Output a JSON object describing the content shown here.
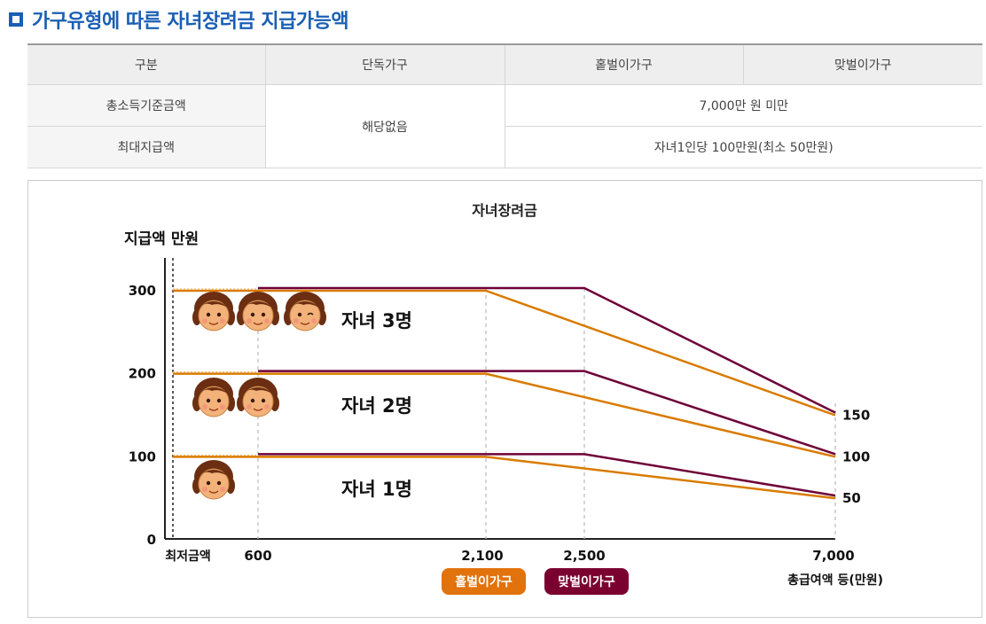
{
  "title": "가구유형에 따른 자녀장려금 지급가능액",
  "table": {
    "headers": [
      "구분",
      "단독가구",
      "홑벌이가구",
      "맞벌이가구"
    ],
    "rows": [
      {
        "label": "총소득기준금액",
        "value": "7,000만 원 미만"
      },
      {
        "label": "최대지급액",
        "value": "자녀1인당 100만원(최소 50만원)"
      }
    ],
    "single_household_value": "해당없음"
  },
  "chart_data": {
    "type": "line",
    "title": "자녀장려금",
    "ylabel": "지급액 만원",
    "xlabel": "총급여액 등(만원)",
    "x_tick_labels": [
      "최저금액",
      "600",
      "2,100",
      "2,500",
      "7,000"
    ],
    "y_tick_labels": [
      "0",
      "100",
      "200",
      "300"
    ],
    "right_labels": [
      "150",
      "100",
      "50"
    ],
    "ylim": [
      0,
      300
    ],
    "groups": [
      {
        "label": "자녀 3명",
        "children": 3,
        "single": {
          "x": [
            0,
            2100,
            7000
          ],
          "y": [
            300,
            300,
            150
          ]
        },
        "dual": {
          "x": [
            600,
            2500,
            7000
          ],
          "y": [
            300,
            300,
            150
          ]
        }
      },
      {
        "label": "자녀 2명",
        "children": 2,
        "single": {
          "x": [
            0,
            2100,
            7000
          ],
          "y": [
            200,
            200,
            100
          ]
        },
        "dual": {
          "x": [
            600,
            2500,
            7000
          ],
          "y": [
            200,
            200,
            100
          ]
        }
      },
      {
        "label": "자녀 1명",
        "children": 1,
        "single": {
          "x": [
            0,
            2100,
            7000
          ],
          "y": [
            100,
            100,
            50
          ]
        },
        "dual": {
          "x": [
            600,
            2500,
            7000
          ],
          "y": [
            100,
            100,
            50
          ]
        }
      }
    ],
    "legend": [
      {
        "name": "홑벌이가구",
        "color": "#e2720c"
      },
      {
        "name": "맞벌이가구",
        "color": "#7a0030"
      }
    ],
    "colors": {
      "single": "#d97b00",
      "dual": "#6e0038"
    },
    "grid": false
  }
}
